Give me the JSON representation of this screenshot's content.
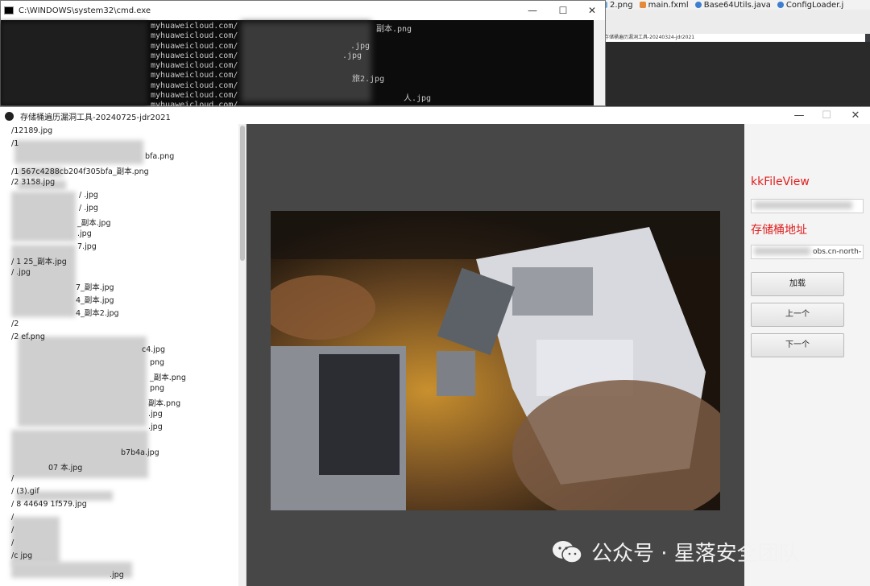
{
  "ide": {
    "tabs": [
      "2.png",
      "main.fxml",
      "Base64Utils.java",
      "ConfigLoader.j"
    ],
    "path": "存储桶遍历漏洞工具-20240324-jdr2021"
  },
  "cmd": {
    "title": "C:\\WINDOWS\\system32\\cmd.exe",
    "controls": [
      "—",
      "☐",
      "✕"
    ],
    "lines": [
      "myhuaweicloud.com/",
      "myhuaweicloud.com/",
      "myhuaweicloud.com/",
      "myhuaweicloud.com/",
      "myhuaweicloud.com/",
      "myhuaweicloud.com/",
      "myhuaweicloud.com/",
      "myhuaweicloud.com/",
      "myhuaweicloud.com/"
    ],
    "tails": [
      "副本.png",
      ".jpg",
      ".jpg",
      "旅2.jpg",
      "人.jpg"
    ]
  },
  "app": {
    "title": "存储桶遍历漏洞工具-20240725-jdr2021",
    "controls": [
      "—",
      "☐",
      "✕"
    ],
    "files": [
      "/12189.jpg",
      "/1",
      "bfa.png",
      "/1        567c4288cb204f305bfa_副本.png",
      "/2        3158.jpg",
      "/         .jpg",
      "/         .jpg",
      "_副本.jpg",
      ".jpg",
      "7.jpg",
      "/         1    25_副本.jpg",
      "/         .jpg",
      "7_副本.jpg",
      "4_副本.jpg",
      "4_副本2.jpg",
      "/2",
      "/2        ef.png",
      "c4.jpg",
      "png",
      "_副本.png",
      "png",
      "副本.png",
      ".jpg",
      ".jpg",
      "",
      "b7b4a.jpg",
      "07        本.jpg",
      "/",
      "/         (3).gif",
      "/     8     44649        1f579.jpg",
      "/",
      "/",
      "/",
      "/c        jpg",
      "",
      ".jpg"
    ]
  },
  "side": {
    "label1": "kkFileView",
    "input1": "",
    "label2": "存储桶地址",
    "input2": "obs.cn-north-",
    "buttons": [
      "加载",
      "上一个",
      "下一个"
    ]
  },
  "watermark": {
    "text": "公众号 · 星落安全团队"
  },
  "colors": {
    "accent_label": "#e02020",
    "preview_bg": "#474747",
    "cmd_bg": "#0c0c0c"
  }
}
